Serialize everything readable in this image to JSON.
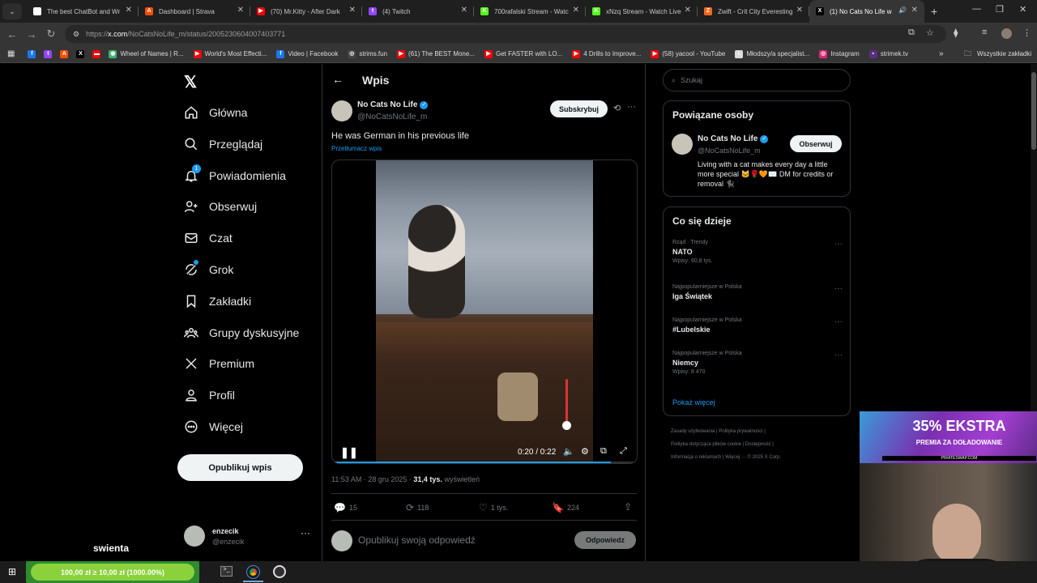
{
  "browser": {
    "tabs": [
      {
        "title": "The best ChatBot and Wr",
        "favicon": "#ffffff",
        "glyph": "◆"
      },
      {
        "title": "Dashboard | Strava",
        "favicon": "#fc4c02",
        "glyph": "A"
      },
      {
        "title": "(70) Mr.Kitty - After Dark",
        "favicon": "#ff0000",
        "glyph": "▶"
      },
      {
        "title": "(4) Twitch",
        "favicon": "#9146ff",
        "glyph": "t"
      },
      {
        "title": "700rafalski Stream - Watc",
        "favicon": "#53fc18",
        "glyph": "K"
      },
      {
        "title": "xNzq Stream - Watch Live",
        "favicon": "#53fc18",
        "glyph": "K"
      },
      {
        "title": "Zwift - Crit City Everesting",
        "favicon": "#fc6719",
        "glyph": "Z"
      },
      {
        "title": "(1) No Cats No Life w",
        "favicon": "#000000",
        "glyph": "X"
      }
    ],
    "url_prefix": "https://",
    "url_host": "x.com",
    "url_path": "/NoCatsNoLife_m/status/2005230604007403771",
    "bookmarks": [
      {
        "label": "",
        "color": "#1877f2",
        "glyph": "f"
      },
      {
        "label": "",
        "color": "#9146ff",
        "glyph": "t"
      },
      {
        "label": "",
        "color": "#fc4c02",
        "glyph": "A"
      },
      {
        "label": "",
        "color": "#000000",
        "glyph": "X"
      },
      {
        "label": "",
        "color": "#ff0000",
        "glyph": "▬"
      },
      {
        "label": "Wheel of Names | R...",
        "color": "#3cb371",
        "glyph": "◉"
      },
      {
        "label": "World's Most Effecti...",
        "color": "#ff0000",
        "glyph": "▶"
      },
      {
        "label": "Video | Facebook",
        "color": "#1877f2",
        "glyph": "f"
      },
      {
        "label": "strims.fun",
        "color": "#444",
        "glyph": "◎"
      },
      {
        "label": "(61) The BEST Mone...",
        "color": "#ff0000",
        "glyph": "▶"
      },
      {
        "label": "Get FASTER with LO...",
        "color": "#ff0000",
        "glyph": "▶"
      },
      {
        "label": "4 Drills to Improve...",
        "color": "#ff0000",
        "glyph": "▶"
      },
      {
        "label": "(58) yacool - YouTube",
        "color": "#ff0000",
        "glyph": "▶"
      },
      {
        "label": "Młodszy/a specjalist...",
        "color": "#ddd",
        "glyph": "◐"
      },
      {
        "label": "Instagram",
        "color": "#d62976",
        "glyph": "◎"
      },
      {
        "label": "strimek.tv",
        "color": "#5a2d82",
        "glyph": "▪"
      }
    ],
    "all_bookmarks": "Wszystkie zakładki"
  },
  "nav": {
    "items": [
      {
        "label": "Główna",
        "icon": "home-icon"
      },
      {
        "label": "Przeglądaj",
        "icon": "search-icon"
      },
      {
        "label": "Powiadomienia",
        "icon": "bell-icon",
        "badge": "1"
      },
      {
        "label": "Obserwuj",
        "icon": "follow-icon"
      },
      {
        "label": "Czat",
        "icon": "mail-icon"
      },
      {
        "label": "Grok",
        "icon": "grok-icon"
      },
      {
        "label": "Zakładki",
        "icon": "bookmark-icon"
      },
      {
        "label": "Grupy dyskusyjne",
        "icon": "communities-icon"
      },
      {
        "label": "Premium",
        "icon": "x-icon"
      },
      {
        "label": "Profil",
        "icon": "profile-icon"
      },
      {
        "label": "Więcej",
        "icon": "more-icon"
      }
    ],
    "post_button": "Opublikuj wpis",
    "user_name": "enzecik",
    "user_handle": "@enzecik",
    "overlay_text": "swienta"
  },
  "post": {
    "header_title": "Wpis",
    "author_name": "No Cats No Life",
    "author_handle": "@NoCatsNoLife_m",
    "subscribe": "Subskrybuj",
    "text": "He was German in his previous life",
    "translate": "Przetłumacz wpis",
    "video_time": "0:20 / 0:22",
    "video_progress": 0.91,
    "timestamp": "11:53 AM · 28 gru 2025 · ",
    "views_count": "31,4 tys.",
    "views_label": " wyświetleń",
    "stats": {
      "replies": "15",
      "reposts": "118",
      "likes": "1 tys.",
      "bookmarks": "224"
    },
    "reply_placeholder": "Opublikuj swoją odpowiedź",
    "reply_button": "Odpowiedz"
  },
  "sidebar": {
    "search_placeholder": "Szukaj",
    "related_title": "Powiązane osoby",
    "related": {
      "name": "No Cats No Life",
      "handle": "@NoCatsNoLife_m",
      "follow": "Obserwuj",
      "bio": "Living with a cat makes every day a little more special 🐱🌹🧡✉️ DM for credits or removal 🐈‍⬛"
    },
    "trends_title": "Co się dzieje",
    "trends": [
      {
        "meta": "Rząd · Trendy",
        "name": "NATO",
        "count": "Wpisy: 60,8 tys."
      },
      {
        "meta": "Najpopularniejsze w Polska",
        "name": "Iga Świątek",
        "count": ""
      },
      {
        "meta": "Najpopularniejsze w Polska",
        "name": "#Lubelskie",
        "count": ""
      },
      {
        "meta": "Najpopularniejsze w Polska",
        "name": "Niemcy",
        "count": "Wpisy: 8 470"
      }
    ],
    "show_more": "Pokaż więcej",
    "footer_line1": "Zasady użytkowania  |  Polityka prywatności  |",
    "footer_line2": "Polityka dotycząca plików cookie  |  Dostępność  |",
    "footer_line3": "Informacja o reklamach  |  Więcej ···  © 2025 X Corp."
  },
  "overlay": {
    "ad_headline": "35% EKSTRA",
    "ad_sub": "PREMIA ZA DOŁADOWANIE",
    "ad_site": "PIRATESWAP.COM",
    "donation": "100,00 zł ≥ 10,00 zł (1000.00%)"
  }
}
